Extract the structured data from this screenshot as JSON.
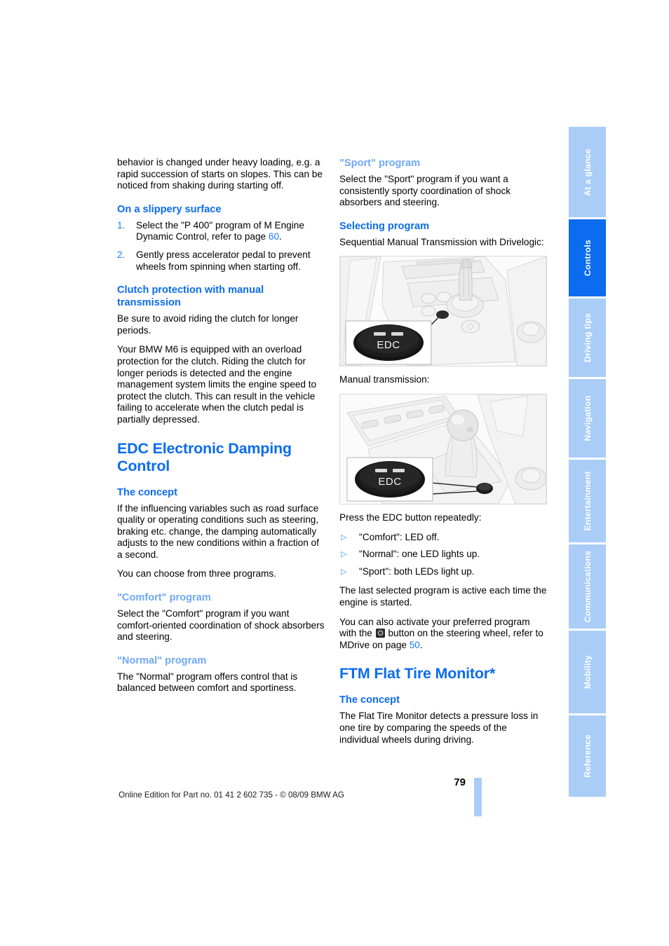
{
  "document": {
    "page_number": "79",
    "footer_note": "Online Edition for Part no. 01 41 2 602 735 - © 08/09 BMW AG",
    "accent_blue": "#0b6cf0",
    "accent_blue_light": "#6fa8f5",
    "tab_blue": "#a9cdf7"
  },
  "tabs": [
    {
      "label": "At a glance",
      "active": false
    },
    {
      "label": "Controls",
      "active": true
    },
    {
      "label": "Driving tips",
      "active": false
    },
    {
      "label": "Navigation",
      "active": false
    },
    {
      "label": "Entertainment",
      "active": false
    },
    {
      "label": "Communications",
      "active": false
    },
    {
      "label": "Mobility",
      "active": false
    },
    {
      "label": "Reference",
      "active": false
    }
  ],
  "left_column": {
    "intro_paragraph": "behavior is changed under heavy loading, e.g. a rapid succession of starts on slopes. This can be noticed from shaking during starting off.",
    "slippery": {
      "heading": "On a slippery surface",
      "step1_pre": "Select the \"P 400\" program of M Engine Dynamic Control, refer to page ",
      "step1_link": "60",
      "step1_post": ".",
      "step2": "Gently press accelerator pedal to prevent wheels from spinning when starting off."
    },
    "clutch": {
      "heading": "Clutch protection with manual transmission",
      "paragraph1": "Be sure to avoid riding the clutch for longer periods.",
      "paragraph2": "Your BMW M6 is equipped with an overload protection for the clutch. Riding the clutch for longer periods is detected and the engine management system limits the engine speed to protect the clutch. This can result in the vehicle failing to accelerate when the clutch pedal is partially depressed."
    },
    "edc": {
      "heading": "EDC Electronic Damping Control",
      "concept_heading": "The concept",
      "concept_paragraph1": "If the influencing variables such as road surface quality or operating conditions such as steering, braking etc. change, the damping automatically adjusts to the new conditions within a fraction of a second.",
      "concept_paragraph2": "You can choose from three programs.",
      "comfort_heading": "\"Comfort\" program",
      "comfort_paragraph": "Select the \"Comfort\" program if you want comfort-oriented coordination of shock absorbers and steering.",
      "normal_heading": "\"Normal\" program",
      "normal_paragraph": "The \"Normal\" program offers control that is balanced between comfort and sportiness."
    }
  },
  "right_column": {
    "sport": {
      "heading": "\"Sport\" program",
      "paragraph": "Select the \"Sport\" program if you want a consistently sporty coordination of shock absorbers and steering."
    },
    "selecting": {
      "heading": "Selecting program",
      "caption_smg": "Sequential Manual Transmission with Drivelogic:",
      "caption_manual": "Manual transmission:",
      "figure_smg_alt": "Center console with Sequential Manual Transmission selector lever and EDC button inset labeled EDC",
      "figure_manual_alt": "Center console with manual transmission shift lever and EDC button inset labeled EDC",
      "button_label": "EDC",
      "instruction": "Press the EDC button repeatedly:",
      "bullets": [
        "\"Comfort\": LED off.",
        "\"Normal\": one LED lights up.",
        "\"Sport\": both LEDs light up."
      ],
      "paragraph_last_selected": "The last selected program is active each time the engine is started.",
      "mdrive_pre": "You can also activate your preferred program with the ",
      "mdrive_mid": " button on the steering wheel, refer to MDrive on page ",
      "mdrive_link": "50",
      "mdrive_post": "."
    },
    "ftm": {
      "heading": "FTM Flat Tire Monitor*",
      "concept_heading": "The concept",
      "concept_paragraph": "The Flat Tire Monitor detects a pressure loss in one tire by comparing the speeds of the individual wheels during driving."
    }
  }
}
